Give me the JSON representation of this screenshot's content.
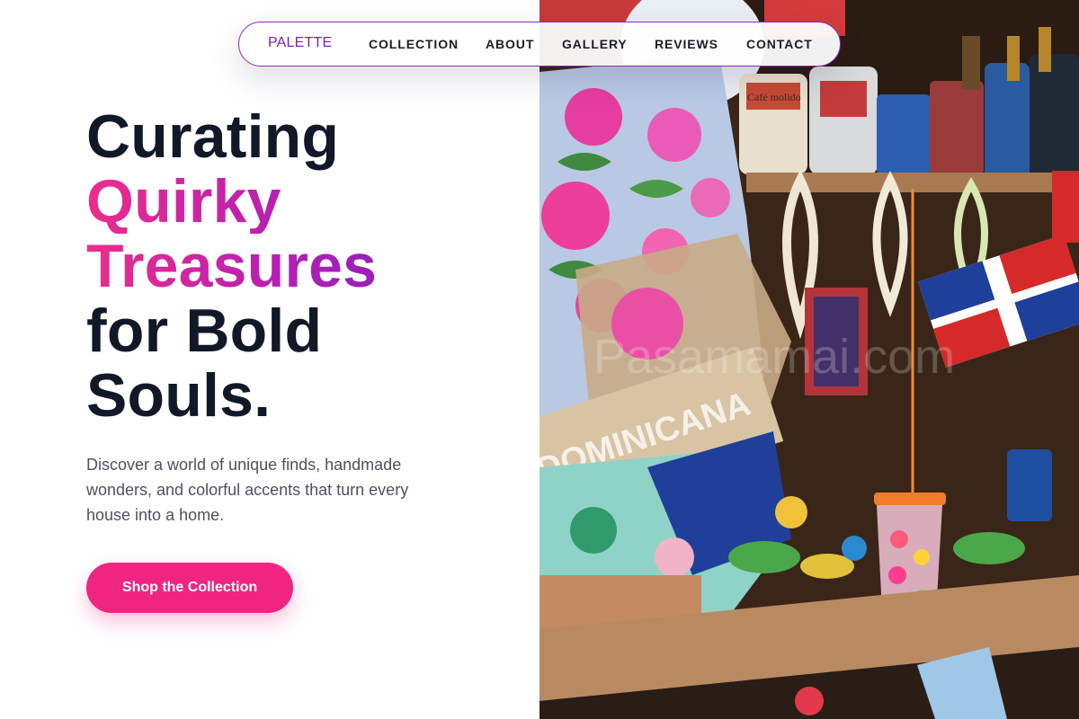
{
  "nav": {
    "brand": "PALETTE",
    "links": [
      "COLLECTION",
      "ABOUT",
      "GALLERY",
      "REVIEWS",
      "CONTACT"
    ]
  },
  "hero": {
    "title_lines": [
      "Curating",
      "Quirky",
      "Treasures",
      "for Bold",
      "Souls."
    ],
    "description": "Discover a world of unique finds, handmade wonders, and colorful accents that turn every house into a home.",
    "cta_label": "Shop the Collection"
  },
  "photo": {
    "sign_text": "DOMINICANA",
    "watermark": "Pasamamai.com",
    "jar_label": "Café molido"
  },
  "colors": {
    "accent_pink": "#f02582",
    "accent_purple": "#7a1fb5",
    "heading_dark": "#111827",
    "body_gray": "#4b5260"
  }
}
